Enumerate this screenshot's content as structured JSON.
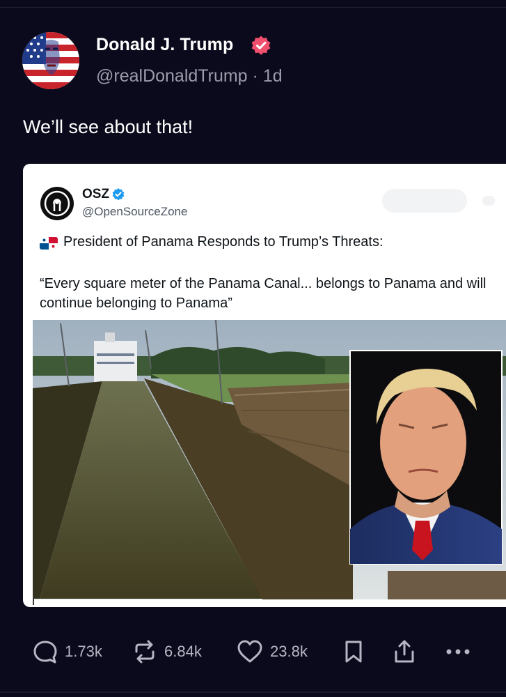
{
  "post": {
    "author_name": "Donald J. Trump",
    "handle": "@realDonaldTrump",
    "separator": "·",
    "time_ago": "1d",
    "text": "We’ll see about that!"
  },
  "embed": {
    "account_name": "OSZ",
    "account_handle": "@OpenSourceZone",
    "headline": "President of Panama Responds to Trump’s Threats:",
    "quote_line1": "“Every square meter of the Panama Canal... belongs to Panama and will",
    "quote_line2": "continue belonging to Panama”"
  },
  "actions": {
    "replies": "1.73k",
    "reposts": "6.84k",
    "likes": "23.8k"
  },
  "icons": {
    "reply": "speech-bubble-icon",
    "repost": "repost-arrows-icon",
    "like": "heart-icon",
    "bookmark": "bookmark-icon",
    "share": "share-upload-icon",
    "more": "ellipsis-icon",
    "verified": "verified-badge-icon",
    "flag": "panama-flag-icon"
  },
  "colors": {
    "background": "#0b0a1c",
    "text": "#ffffff",
    "muted": "#9c9bab",
    "verified_badge": "#f0506e",
    "embed_verified": "#1d9bf0"
  }
}
